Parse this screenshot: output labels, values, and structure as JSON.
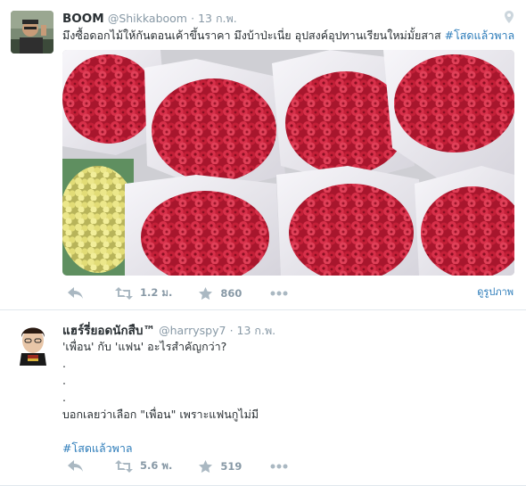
{
  "tweets": [
    {
      "fullname": "BOOM",
      "username": "@Shikkaboom",
      "time": "· 13 ก.พ.",
      "text": "มึงซื้อดอกไม้ให้กันตอนเค้าขึ้นราคา  มึงบ้าป่ะเนี่ย  อุปสงค์อุปทานเรียนใหม่มั้ยสาส ",
      "hashtag": "#โสดแล้วพาล",
      "retweets": "1.2 ม.",
      "likes": "860",
      "view_photo": "ดูรูปภาพ",
      "image_description_colors": {
        "rose": "#c8203a",
        "paper": "#f0eff4",
        "yellow": "#e8e27a"
      }
    },
    {
      "fullname": "แฮร์รี่ยอดนักสืบ™",
      "username": "@harryspy7",
      "time": "· 13 ก.พ.",
      "lines": [
        "'เพื่อน' กับ 'แฟน' อะไรสำคัญกว่า?",
        ".",
        ".",
        ".",
        "บอกเลยว่าเลือก \"เพื่อน\" เพราะแฟนกูไม่มี"
      ],
      "hashtag": "#โสดแล้วพาล",
      "retweets": "5.6 พ.",
      "likes": "519"
    }
  ],
  "colors": {
    "link": "#2b7bb9",
    "muted": "#8899a6",
    "text": "#292f33",
    "icon": "#aab8c2"
  },
  "icons": [
    "reply-icon",
    "retweet-icon",
    "like-icon",
    "more-icon",
    "location-icon"
  ]
}
